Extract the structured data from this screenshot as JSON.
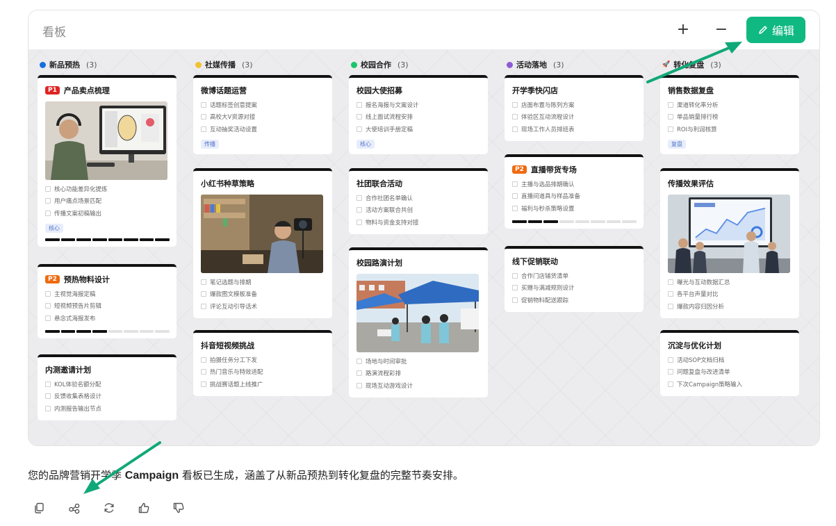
{
  "panel": {
    "title": "看板",
    "plus_label": "+",
    "minus_label": "−",
    "edit_label": "编辑"
  },
  "columns": [
    {
      "name": "新品预热",
      "count": "(3)",
      "color": "#1a6fe0",
      "icon": "dot",
      "cards": [
        {
          "priority": "P1",
          "priority_color": "#e02424",
          "title": "产品卖点梳理",
          "image": "designer-illustration",
          "tasks": [
            "核心功能差异化提炼",
            "用户痛点场景匹配",
            "传播文案初稿输出"
          ],
          "tag": "核心",
          "progress": 1.0
        },
        {
          "priority": "P2",
          "priority_color": "#f06a0f",
          "title": "预热物料设计",
          "tasks": [
            "主视觉海报定稿",
            "短视频预告片剪辑",
            "悬念式海报发布"
          ],
          "progress": 0.5
        },
        {
          "title": "内测邀请计划",
          "tasks": [
            "KOL体验名额分配",
            "反馈收集表格设计",
            "内测报告输出节点"
          ]
        }
      ]
    },
    {
      "name": "社媒传播",
      "count": "(3)",
      "color": "#f2c12e",
      "icon": "dot",
      "cards": [
        {
          "title": "微博话题运营",
          "tasks": [
            "话题标签创意提案",
            "高校大V资源对接",
            "互动抽奖活动设置"
          ],
          "tag": "传播"
        },
        {
          "title": "小红书种草策略",
          "image": "dorm-vlogger-photo",
          "tasks": [
            "笔记选题与排期",
            "爆款图文模板准备",
            "评论互动引导话术"
          ]
        },
        {
          "title": "抖音短视频挑战",
          "tasks": [
            "拍摄任务分工下发",
            "热门音乐与特效适配",
            "挑战赛话题上线推广"
          ]
        }
      ]
    },
    {
      "name": "校园合作",
      "count": "(3)",
      "color": "#1cc46b",
      "icon": "dot",
      "cards": [
        {
          "title": "校园大使招募",
          "tasks": [
            "报名海报与文案设计",
            "线上面试流程安排",
            "大使培训手册定稿"
          ],
          "tag": "核心"
        },
        {
          "title": "社团联合活动",
          "tasks": [
            "合作社团名单确认",
            "活动方案联合共创",
            "物料与资金支持对接"
          ]
        },
        {
          "title": "校园路演计划",
          "image": "campus-roadshow-photo",
          "tasks": [
            "场地与时间审批",
            "路演流程彩排",
            "现场互动游戏设计"
          ]
        }
      ]
    },
    {
      "name": "活动落地",
      "count": "(3)",
      "color": "#8e5bd6",
      "icon": "dot",
      "cards": [
        {
          "title": "开学季快闪店",
          "tasks": [
            "店面布置与陈列方案",
            "体验区互动流程设计",
            "现场工作人员排班表"
          ]
        },
        {
          "priority": "P2",
          "priority_color": "#f06a0f",
          "title": "直播带货专场",
          "tasks": [
            "主播与选品排期确认",
            "直播间道具与样品准备",
            "福利与秒杀策略设置"
          ],
          "progress": 0.375
        },
        {
          "title": "线下促销联动",
          "tasks": [
            "合作门店铺货清单",
            "买赠与满减规则设计",
            "促销物料配送跟踪"
          ]
        }
      ]
    },
    {
      "name": "转化复盘",
      "count": "(3)",
      "color": "#e0457a",
      "icon": "rocket-icon",
      "cards": [
        {
          "title": "销售数据复盘",
          "tasks": [
            "渠道转化率分析",
            "单品销量排行榜",
            "ROI与利润核算"
          ],
          "tag": "复盘"
        },
        {
          "title": "传播效果评估",
          "image": "meeting-dashboard-photo",
          "tasks": [
            "曝光与互动数据汇总",
            "各平台声量对比",
            "爆款内容归因分析"
          ]
        },
        {
          "title": "沉淀与优化计划",
          "tasks": [
            "活动SOP文档归档",
            "问题复盘与改进清单",
            "下次Campaign策略输入"
          ]
        }
      ]
    }
  ],
  "summary": {
    "before": "您的品牌营销开学季 ",
    "bold": "Campaign",
    "after": " 看板已生成，涵盖了从新品预热到转化复盘的完整节奏安排。"
  },
  "actions": [
    {
      "name": "copy-icon"
    },
    {
      "name": "share-icon"
    },
    {
      "name": "regenerate-icon"
    },
    {
      "name": "thumbs-up-icon"
    },
    {
      "name": "thumbs-down-icon"
    }
  ],
  "colors": {
    "accent": "#10b981",
    "arrow": "#10a878",
    "card_border": "#111111"
  }
}
